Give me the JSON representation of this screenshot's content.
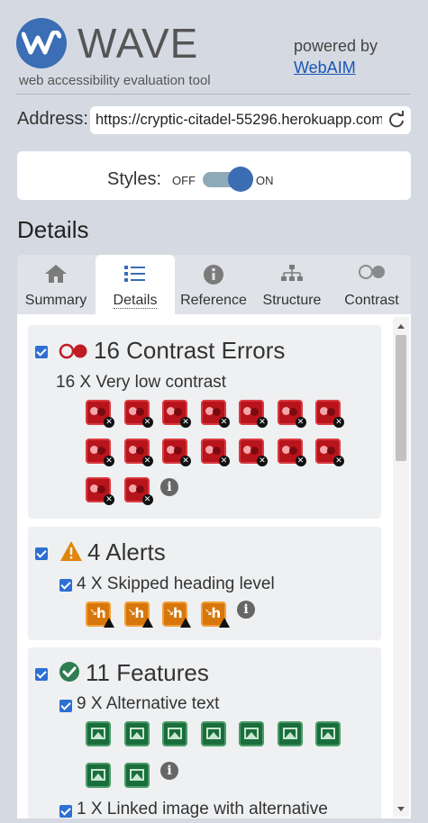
{
  "header": {
    "logo_text": "WAVE",
    "tagline": "web accessibility evaluation tool",
    "powered_by": "powered by",
    "powered_link": "WebAIM"
  },
  "address": {
    "label": "Address:",
    "value": "https://cryptic-citadel-55296.herokuapp.com"
  },
  "styles": {
    "label": "Styles:",
    "off": "OFF",
    "on": "ON",
    "state": "on"
  },
  "details_heading": "Details",
  "tabs": [
    {
      "label": "Summary",
      "icon": "home-icon"
    },
    {
      "label": "Details",
      "icon": "list-icon",
      "active": true
    },
    {
      "label": "Reference",
      "icon": "info-icon"
    },
    {
      "label": "Structure",
      "icon": "sitemap-icon"
    },
    {
      "label": "Contrast",
      "icon": "contrast-icon"
    }
  ],
  "sections": {
    "contrast": {
      "title": "16 Contrast Errors",
      "item": "16 X Very low contrast",
      "count": 16
    },
    "alerts": {
      "title": "4 Alerts",
      "item": "4 X Skipped heading level",
      "count": 4
    },
    "features": {
      "title": "11 Features",
      "item1": "9 X Alternative text",
      "count1": 9,
      "item2": "1 X Linked image with alternative"
    }
  },
  "colors": {
    "accent": "#3a6db4",
    "error": "#b8141c",
    "alert": "#d7760a",
    "feature": "#1a6e3b"
  }
}
